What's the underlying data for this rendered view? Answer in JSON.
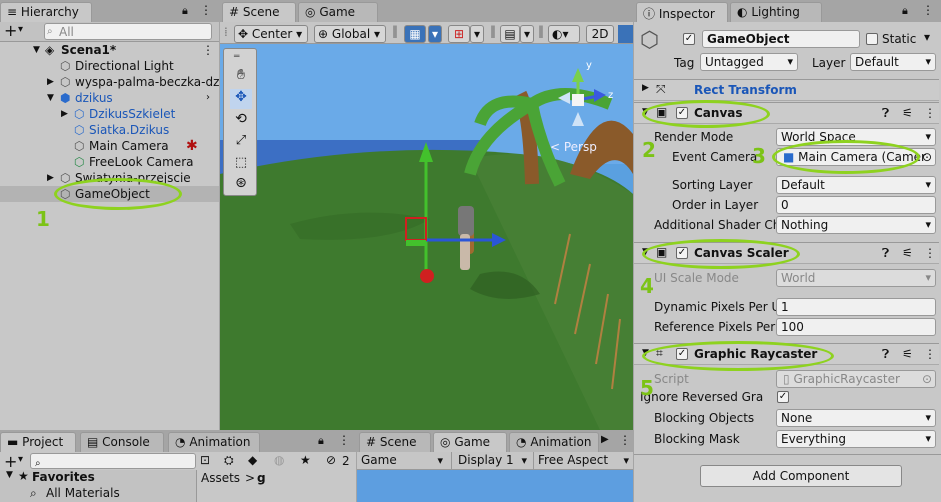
{
  "hierarchy": {
    "tab": "Hierarchy",
    "search_placeholder": "All",
    "add_label": "+",
    "scene": "Scena1*",
    "items": [
      {
        "label": "Directional Light"
      },
      {
        "label": "wyspa-palma-beczka-dz"
      },
      {
        "label": "dzikus"
      },
      {
        "label": "DzikusSzkielet"
      },
      {
        "label": "Siatka.Dzikus"
      },
      {
        "label": "Main Camera"
      },
      {
        "label": "FreeLook Camera"
      },
      {
        "label": "Swiatynia-przejscie"
      },
      {
        "label": "GameObject"
      }
    ]
  },
  "scene_view": {
    "tabs": [
      "Scene",
      "Game"
    ],
    "pivot": "Center",
    "space": "Global",
    "mode_2d": "2D",
    "persp_label": "< Persp",
    "gizmo_axes": {
      "y": "y",
      "z": "z"
    }
  },
  "inspector": {
    "tabs": [
      "Inspector",
      "Lighting"
    ],
    "object_name": "GameObject",
    "static_label": "Static",
    "tag_label": "Tag",
    "tag_value": "Untagged",
    "layer_label": "Layer",
    "layer_value": "Default",
    "rect_transform": "Rect Transform",
    "canvas": {
      "title": "Canvas",
      "render_mode_label": "Render Mode",
      "render_mode_value": "World Space",
      "event_camera_label": "Event Camera",
      "event_camera_value": "Main Camera (Camer",
      "sorting_layer_label": "Sorting Layer",
      "sorting_layer_value": "Default",
      "order_label": "Order in Layer",
      "order_value": "0",
      "shader_label": "Additional Shader Ch",
      "shader_value": "Nothing"
    },
    "canvas_scaler": {
      "title": "Canvas Scaler",
      "ui_scale_label": "UI Scale Mode",
      "ui_scale_value": "World",
      "dynamic_label": "Dynamic Pixels Per U",
      "dynamic_value": "1",
      "reference_label": "Reference Pixels Per",
      "reference_value": "100"
    },
    "raycaster": {
      "title": "Graphic Raycaster",
      "script_label": "Script",
      "script_value": "GraphicRaycaster",
      "ignore_label": "Ignore Reversed Gra",
      "blocking_objects_label": "Blocking Objects",
      "blocking_objects_value": "None",
      "blocking_mask_label": "Blocking Mask",
      "blocking_mask_value": "Everything"
    },
    "add_component": "Add Component"
  },
  "project": {
    "tabs": [
      "Project",
      "Console",
      "Animation"
    ],
    "favorites": "Favorites",
    "all_materials": "All Materials",
    "assets_path": "Assets",
    "assets_sep": ">",
    "assets_folder": "g",
    "hidden_count": "2"
  },
  "game_panel": {
    "tabs": [
      "Scene",
      "Game",
      "Animation"
    ],
    "display_mode": "Game",
    "display": "Display 1",
    "aspect": "Free Aspect"
  },
  "annotations": [
    "1",
    "2",
    "3",
    "4",
    "5"
  ],
  "colors": {
    "annotation": "#8ed21f",
    "selection": "#3a72b8",
    "sky": "#5aa0e0",
    "grass": "#3e7a2e",
    "water": "#3c6fc4"
  }
}
